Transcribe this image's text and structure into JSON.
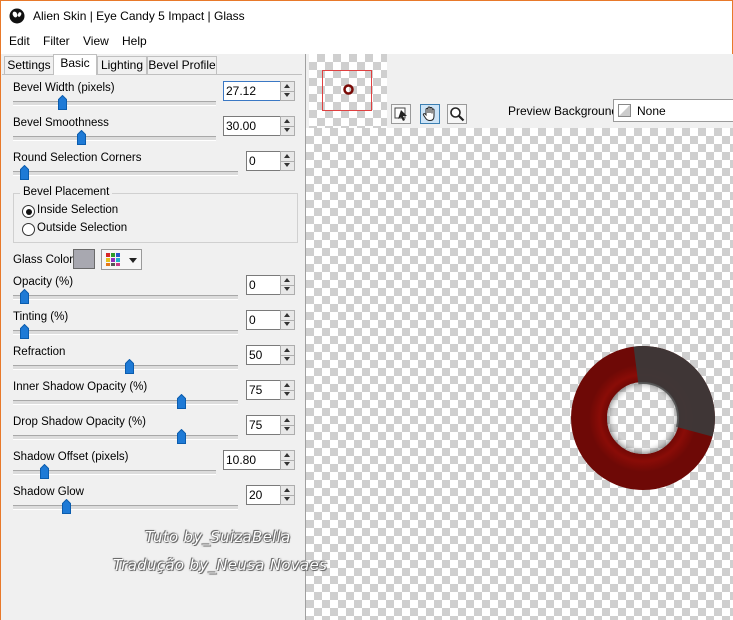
{
  "window": {
    "title": "Alien Skin | Eye Candy 5 Impact | Glass",
    "accent_color": "#e8792a"
  },
  "menu": [
    "Edit",
    "Filter",
    "View",
    "Help"
  ],
  "tabs": [
    {
      "label": "Settings",
      "active": false
    },
    {
      "label": "Basic",
      "active": true
    },
    {
      "label": "Lighting",
      "active": false
    },
    {
      "label": "Bevel Profile",
      "active": false
    }
  ],
  "controls": {
    "bevel_width": {
      "label": "Bevel Width (pixels)",
      "value": "27.12"
    },
    "bevel_smoothness": {
      "label": "Bevel Smoothness",
      "value": "30.00"
    },
    "round_corners": {
      "label": "Round Selection Corners",
      "value": "0"
    },
    "bevel_placement": {
      "title": "Bevel Placement",
      "options": [
        "Inside Selection",
        "Outside Selection"
      ],
      "selected": "Inside Selection"
    },
    "glass_color": {
      "label": "Glass Color",
      "swatch": "#a8a8b0"
    },
    "opacity": {
      "label": "Opacity (%)",
      "value": "0"
    },
    "tinting": {
      "label": "Tinting (%)",
      "value": "0"
    },
    "refraction": {
      "label": "Refraction",
      "value": "50"
    },
    "inner_shadow_opacity": {
      "label": "Inner Shadow Opacity (%)",
      "value": "75"
    },
    "drop_shadow_opacity": {
      "label": "Drop Shadow Opacity (%)",
      "value": "75"
    },
    "shadow_offset": {
      "label": "Shadow Offset (pixels)",
      "value": "10.80"
    },
    "shadow_glow": {
      "label": "Shadow Glow",
      "value": "20"
    }
  },
  "preview": {
    "background_label": "Preview Background:",
    "background_value": "None",
    "ring_color": "#7a0a06",
    "ring_dark_color": "#3a3a3a"
  },
  "watermark": {
    "line1": "Tuto by_SuizaBella",
    "line2": "Tradução by_Neusa Novaes"
  }
}
